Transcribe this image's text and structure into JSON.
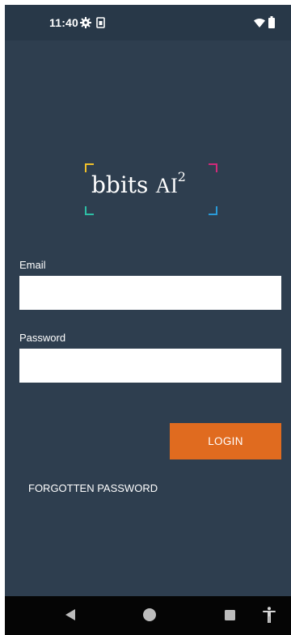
{
  "status_bar": {
    "time": "11:40",
    "icons": [
      "gear-icon",
      "sim-card-icon",
      "wifi-icon",
      "battery-icon"
    ]
  },
  "logo": {
    "name": "bbits",
    "ai": "AI",
    "superscript": "2",
    "bracket_colors": {
      "top_left": "#f1c12a",
      "top_right": "#d12a7a",
      "bottom_left": "#2dbfa5",
      "bottom_right": "#2a9bd9"
    }
  },
  "form": {
    "email_label": "Email",
    "email_value": "",
    "password_label": "Password",
    "password_value": "",
    "login_label": "LOGIN",
    "forgot_label": "FORGOTTEN PASSWORD"
  },
  "nav_bar": {
    "icons": [
      "back-icon",
      "home-icon",
      "recents-icon",
      "accessibility-icon"
    ]
  },
  "colors": {
    "background": "#2e3e4f",
    "status_bar": "#283848",
    "accent": "#e06b1f",
    "nav_bar": "#050505"
  }
}
